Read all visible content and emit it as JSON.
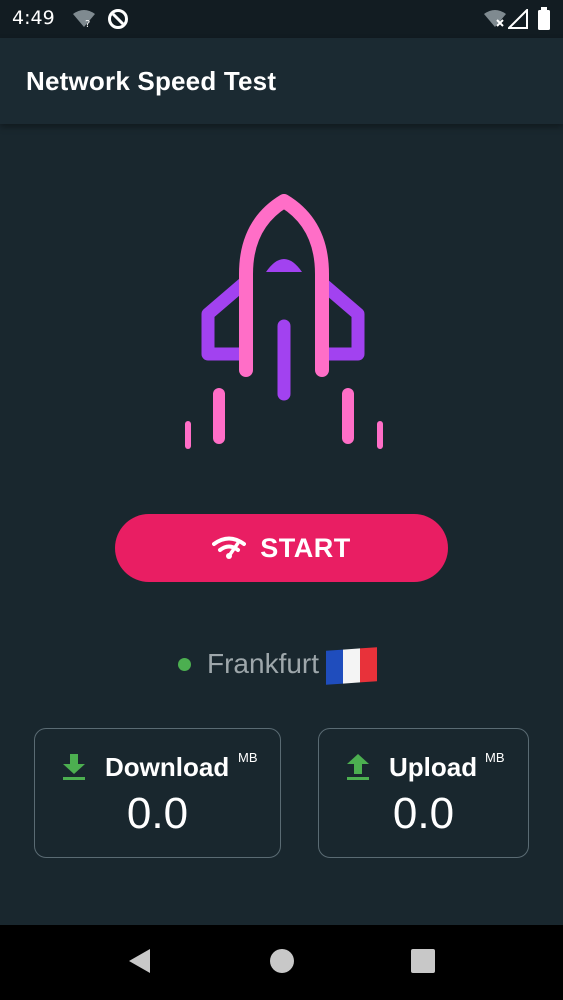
{
  "status_bar": {
    "time": "4:49",
    "icons": [
      "wifi-unknown-icon",
      "no-disturb-icon",
      "wifi-off-icon",
      "signal-icon",
      "battery-icon"
    ]
  },
  "app_bar": {
    "title": "Network Speed Test"
  },
  "hero": {
    "icon": "rocket-icon",
    "colors": {
      "pink": "#ff6ec7",
      "purple": "#a242f0"
    }
  },
  "start_button": {
    "label": "START",
    "icon": "wifi-speed-icon",
    "color": "#e91e63"
  },
  "server": {
    "name": "Frankfurt",
    "status_color": "#4caf50",
    "flag": "france-flag"
  },
  "stats": {
    "download": {
      "label": "Download",
      "unit": "MB",
      "value": "0.0",
      "icon": "download-icon"
    },
    "upload": {
      "label": "Upload",
      "unit": "MB",
      "value": "0.0",
      "icon": "upload-icon"
    }
  },
  "nav": {
    "items": [
      "back-icon",
      "home-icon",
      "recents-icon"
    ]
  }
}
